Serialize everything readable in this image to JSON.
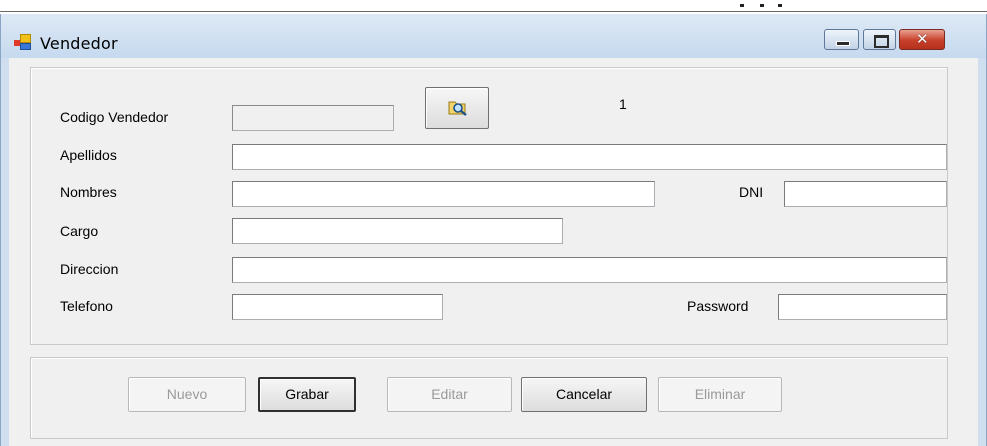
{
  "window": {
    "title": "Vendedor",
    "icon": "app-window-icon",
    "title_bar_buttons": [
      "minimize",
      "maximize",
      "close"
    ]
  },
  "form": {
    "codigo_label": "Codigo Vendedor",
    "codigo_value": "",
    "search_icon": "folder-search-icon",
    "record_number": "1",
    "apellidos_label": "Apellidos",
    "apellidos_value": "",
    "nombres_label": "Nombres",
    "nombres_value": "",
    "dni_label": "DNI",
    "dni_value": "",
    "cargo_label": "Cargo",
    "cargo_value": "",
    "direccion_label": "Direccion",
    "direccion_value": "",
    "telefono_label": "Telefono",
    "telefono_value": "",
    "password_label": "Password",
    "password_value": ""
  },
  "actions": {
    "nuevo": "Nuevo",
    "grabar": "Grabar",
    "editar": "Editar",
    "cancelar": "Cancelar",
    "eliminar": "Eliminar"
  },
  "colors": {
    "titlebar": "#cfdff0",
    "client": "#f0f0f0",
    "close_button": "#c7402a",
    "disabled_text": "#9a9a9a"
  }
}
